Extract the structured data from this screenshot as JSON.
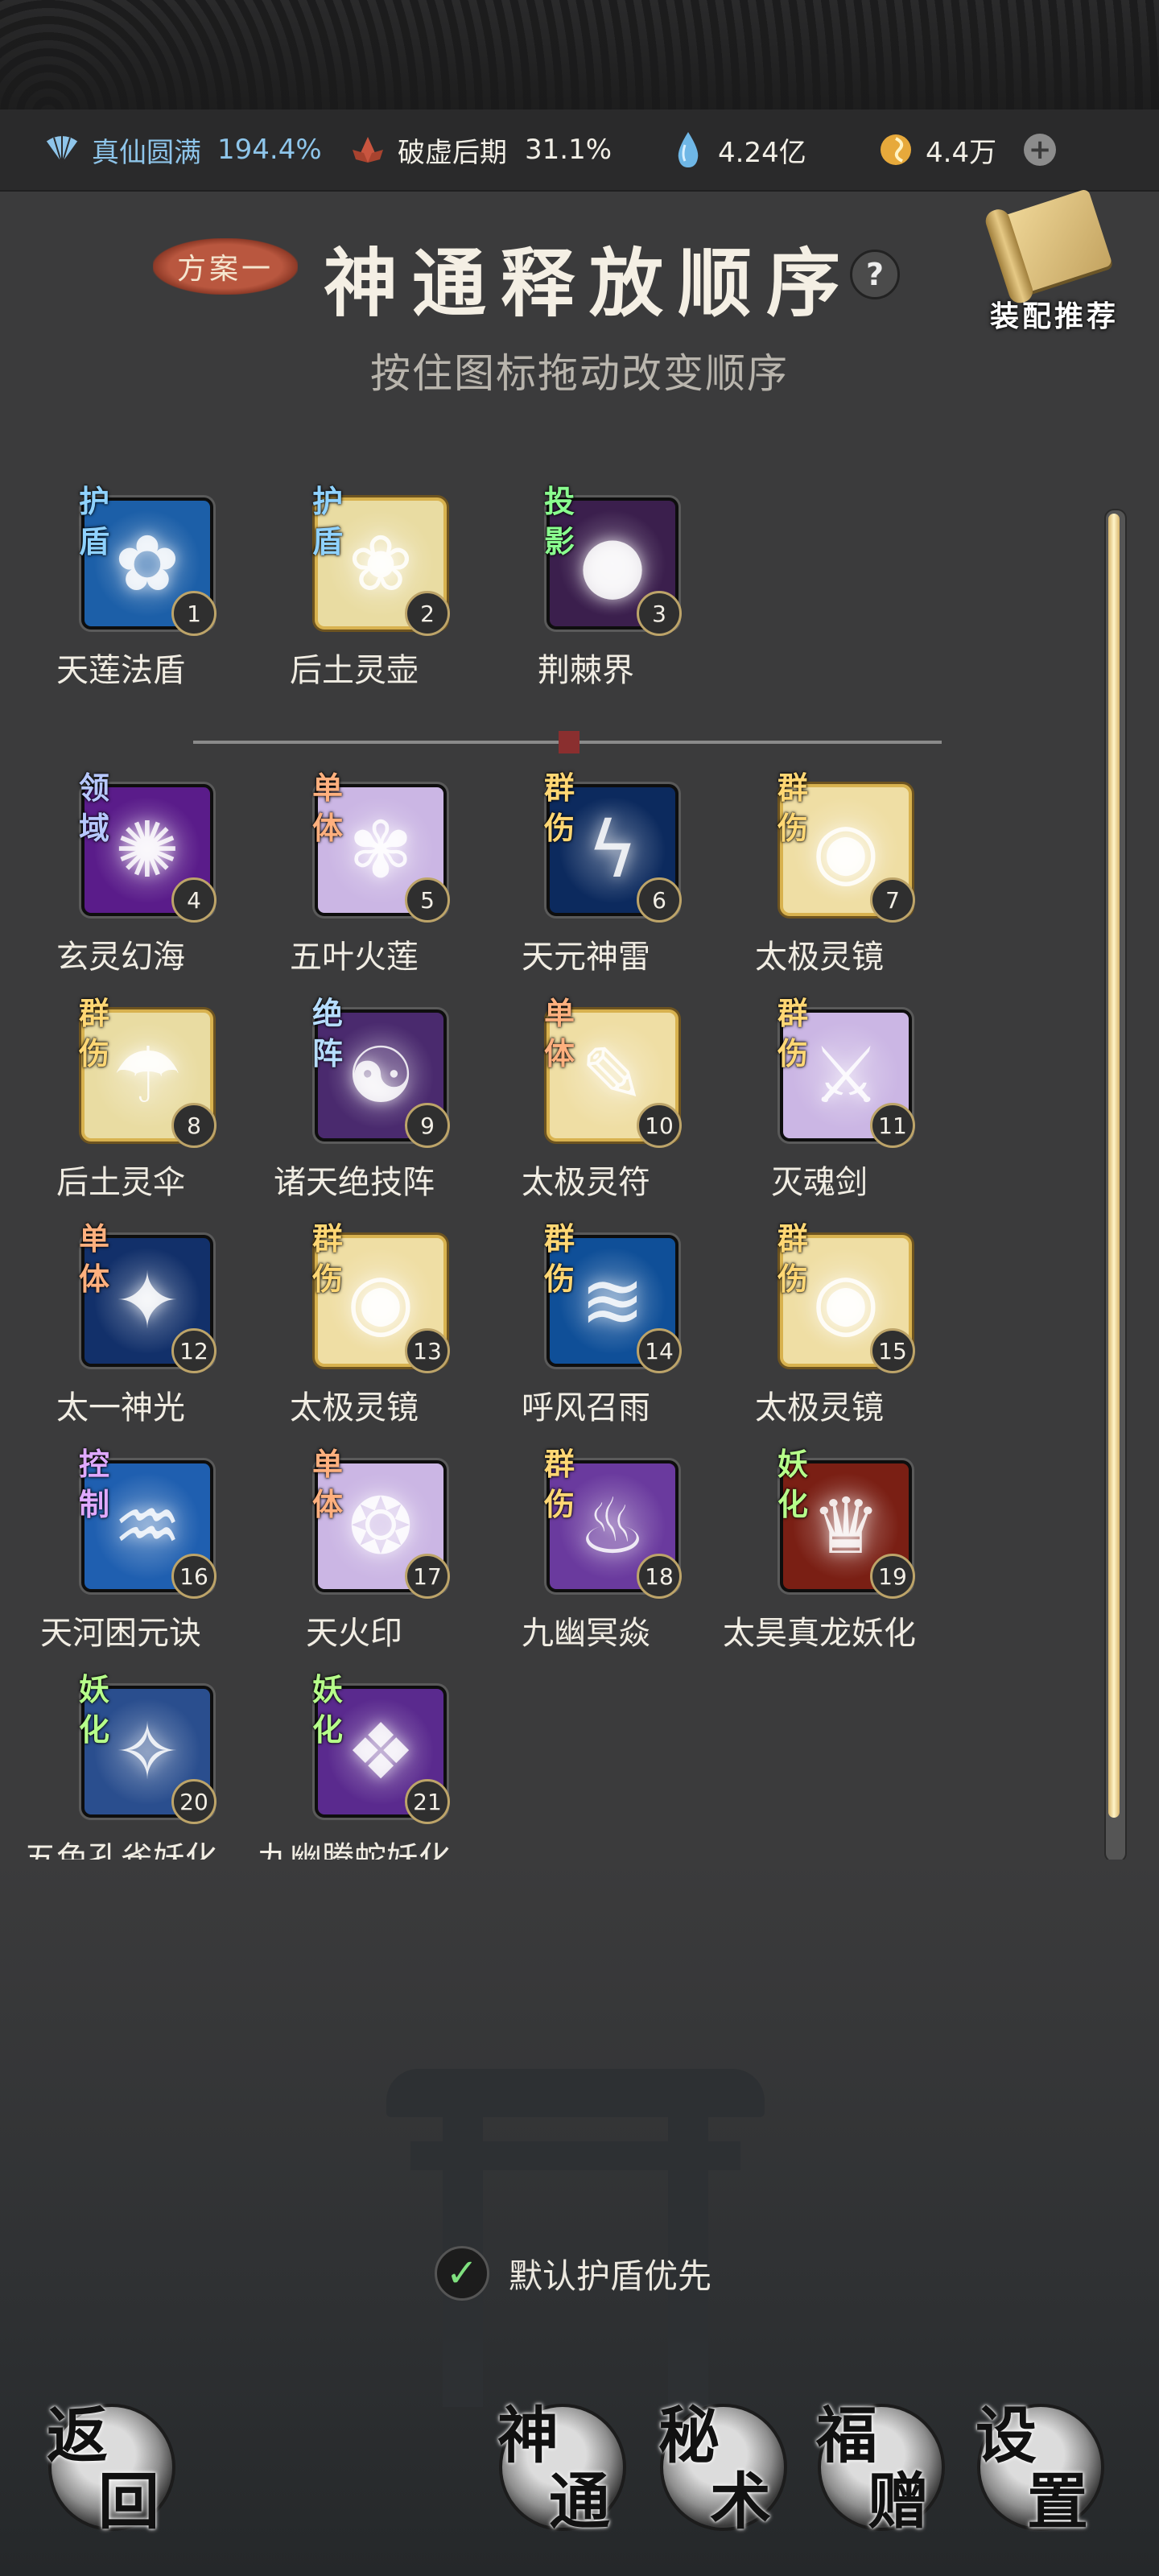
{
  "resources": {
    "realm_label": "真仙圆满",
    "realm_value": "194.4%",
    "break_label": "破虚后期",
    "break_value": "31.1%",
    "stone": "4.24亿",
    "coin": "4.4万"
  },
  "header": {
    "plan": "方案一",
    "title": "神通释放顺序",
    "help": "?",
    "recommend": "装配推荐",
    "subtitle": "按住图标拖动改变顺序"
  },
  "skills": [
    {
      "num": "1",
      "name": "天莲法盾",
      "tag": "护盾",
      "tagType": "shield",
      "bg": "#1c5fa8",
      "glyph": "✿",
      "gold": false
    },
    {
      "num": "2",
      "name": "后土灵壶",
      "tag": "护盾",
      "tagType": "shield",
      "bg": "#e9dca2",
      "glyph": "❀",
      "gold": true
    },
    {
      "num": "3",
      "name": "荆棘界",
      "tag": "投影",
      "tagType": "proj",
      "bg": "#3b1f4d",
      "glyph": "●",
      "gold": false
    },
    {
      "num": "4",
      "name": "玄灵幻海",
      "tag": "领域",
      "tagType": "domain",
      "bg": "#5a1c8a",
      "glyph": "✺",
      "gold": false
    },
    {
      "num": "5",
      "name": "五叶火莲",
      "tag": "单体",
      "tagType": "single",
      "bg": "#cbb6e4",
      "glyph": "✾",
      "gold": false
    },
    {
      "num": "6",
      "name": "天元神雷",
      "tag": "群伤",
      "tagType": "aoe",
      "bg": "#0c2a5e",
      "glyph": "ϟ",
      "gold": false
    },
    {
      "num": "7",
      "name": "太极灵镜",
      "tag": "群伤",
      "tagType": "aoe",
      "bg": "#efdea4",
      "glyph": "◉",
      "gold": true
    },
    {
      "num": "8",
      "name": "后土灵伞",
      "tag": "群伤",
      "tagType": "aoe",
      "bg": "#e9dca2",
      "glyph": "☂",
      "gold": true
    },
    {
      "num": "9",
      "name": "诸天绝技阵",
      "tag": "绝阵",
      "tagType": "array",
      "bg": "#4a2a6e",
      "glyph": "☯",
      "gold": false
    },
    {
      "num": "10",
      "name": "太极灵符",
      "tag": "单体",
      "tagType": "single",
      "bg": "#efdea4",
      "glyph": "✎",
      "gold": true
    },
    {
      "num": "11",
      "name": "灭魂剑",
      "tag": "群伤",
      "tagType": "aoe",
      "bg": "#cbb6e4",
      "glyph": "⚔",
      "gold": false
    },
    {
      "num": "12",
      "name": "太一神光",
      "tag": "单体",
      "tagType": "single",
      "bg": "#12306a",
      "glyph": "✦",
      "gold": false
    },
    {
      "num": "13",
      "name": "太极灵镜",
      "tag": "群伤",
      "tagType": "aoe",
      "bg": "#efdea4",
      "glyph": "◉",
      "gold": true
    },
    {
      "num": "14",
      "name": "呼风召雨",
      "tag": "群伤",
      "tagType": "aoe",
      "bg": "#0f4f98",
      "glyph": "≋",
      "gold": false
    },
    {
      "num": "15",
      "name": "太极灵镜",
      "tag": "群伤",
      "tagType": "aoe",
      "bg": "#efdea4",
      "glyph": "◉",
      "gold": true
    },
    {
      "num": "16",
      "name": "天河困元诀",
      "tag": "控制",
      "tagType": "control",
      "bg": "#1f5fb0",
      "glyph": "♒",
      "gold": false
    },
    {
      "num": "17",
      "name": "天火印",
      "tag": "单体",
      "tagType": "single",
      "bg": "#cbb6e4",
      "glyph": "❂",
      "gold": false
    },
    {
      "num": "18",
      "name": "九幽冥焱",
      "tag": "群伤",
      "tagType": "aoe",
      "bg": "#6a3a9e",
      "glyph": "♨",
      "gold": false
    },
    {
      "num": "19",
      "name": "太昊真龙妖化",
      "tag": "妖化",
      "tagType": "demon",
      "bg": "#7a1f14",
      "glyph": "♛",
      "gold": false
    },
    {
      "num": "20",
      "name": "五色孔雀妖化",
      "tag": "妖化",
      "tagType": "demon",
      "bg": "#2a4e8e",
      "glyph": "✧",
      "gold": false
    },
    {
      "num": "21",
      "name": "九幽腾蛇妖化",
      "tag": "妖化",
      "tagType": "demon",
      "bg": "#5a2a8e",
      "glyph": "❖",
      "gold": false
    }
  ],
  "option": {
    "checked": true,
    "label": "默认护盾优先"
  },
  "nav": {
    "back": [
      "返",
      "回"
    ],
    "shentong": [
      "神",
      "通"
    ],
    "mishu": [
      "秘",
      "术"
    ],
    "fuzeng": [
      "福",
      "赠"
    ],
    "settings": [
      "设",
      "置"
    ]
  },
  "colors": {
    "background": "#3b3b3c",
    "accent_blue": "#8ec5ea",
    "gold": "#d8b24f"
  }
}
